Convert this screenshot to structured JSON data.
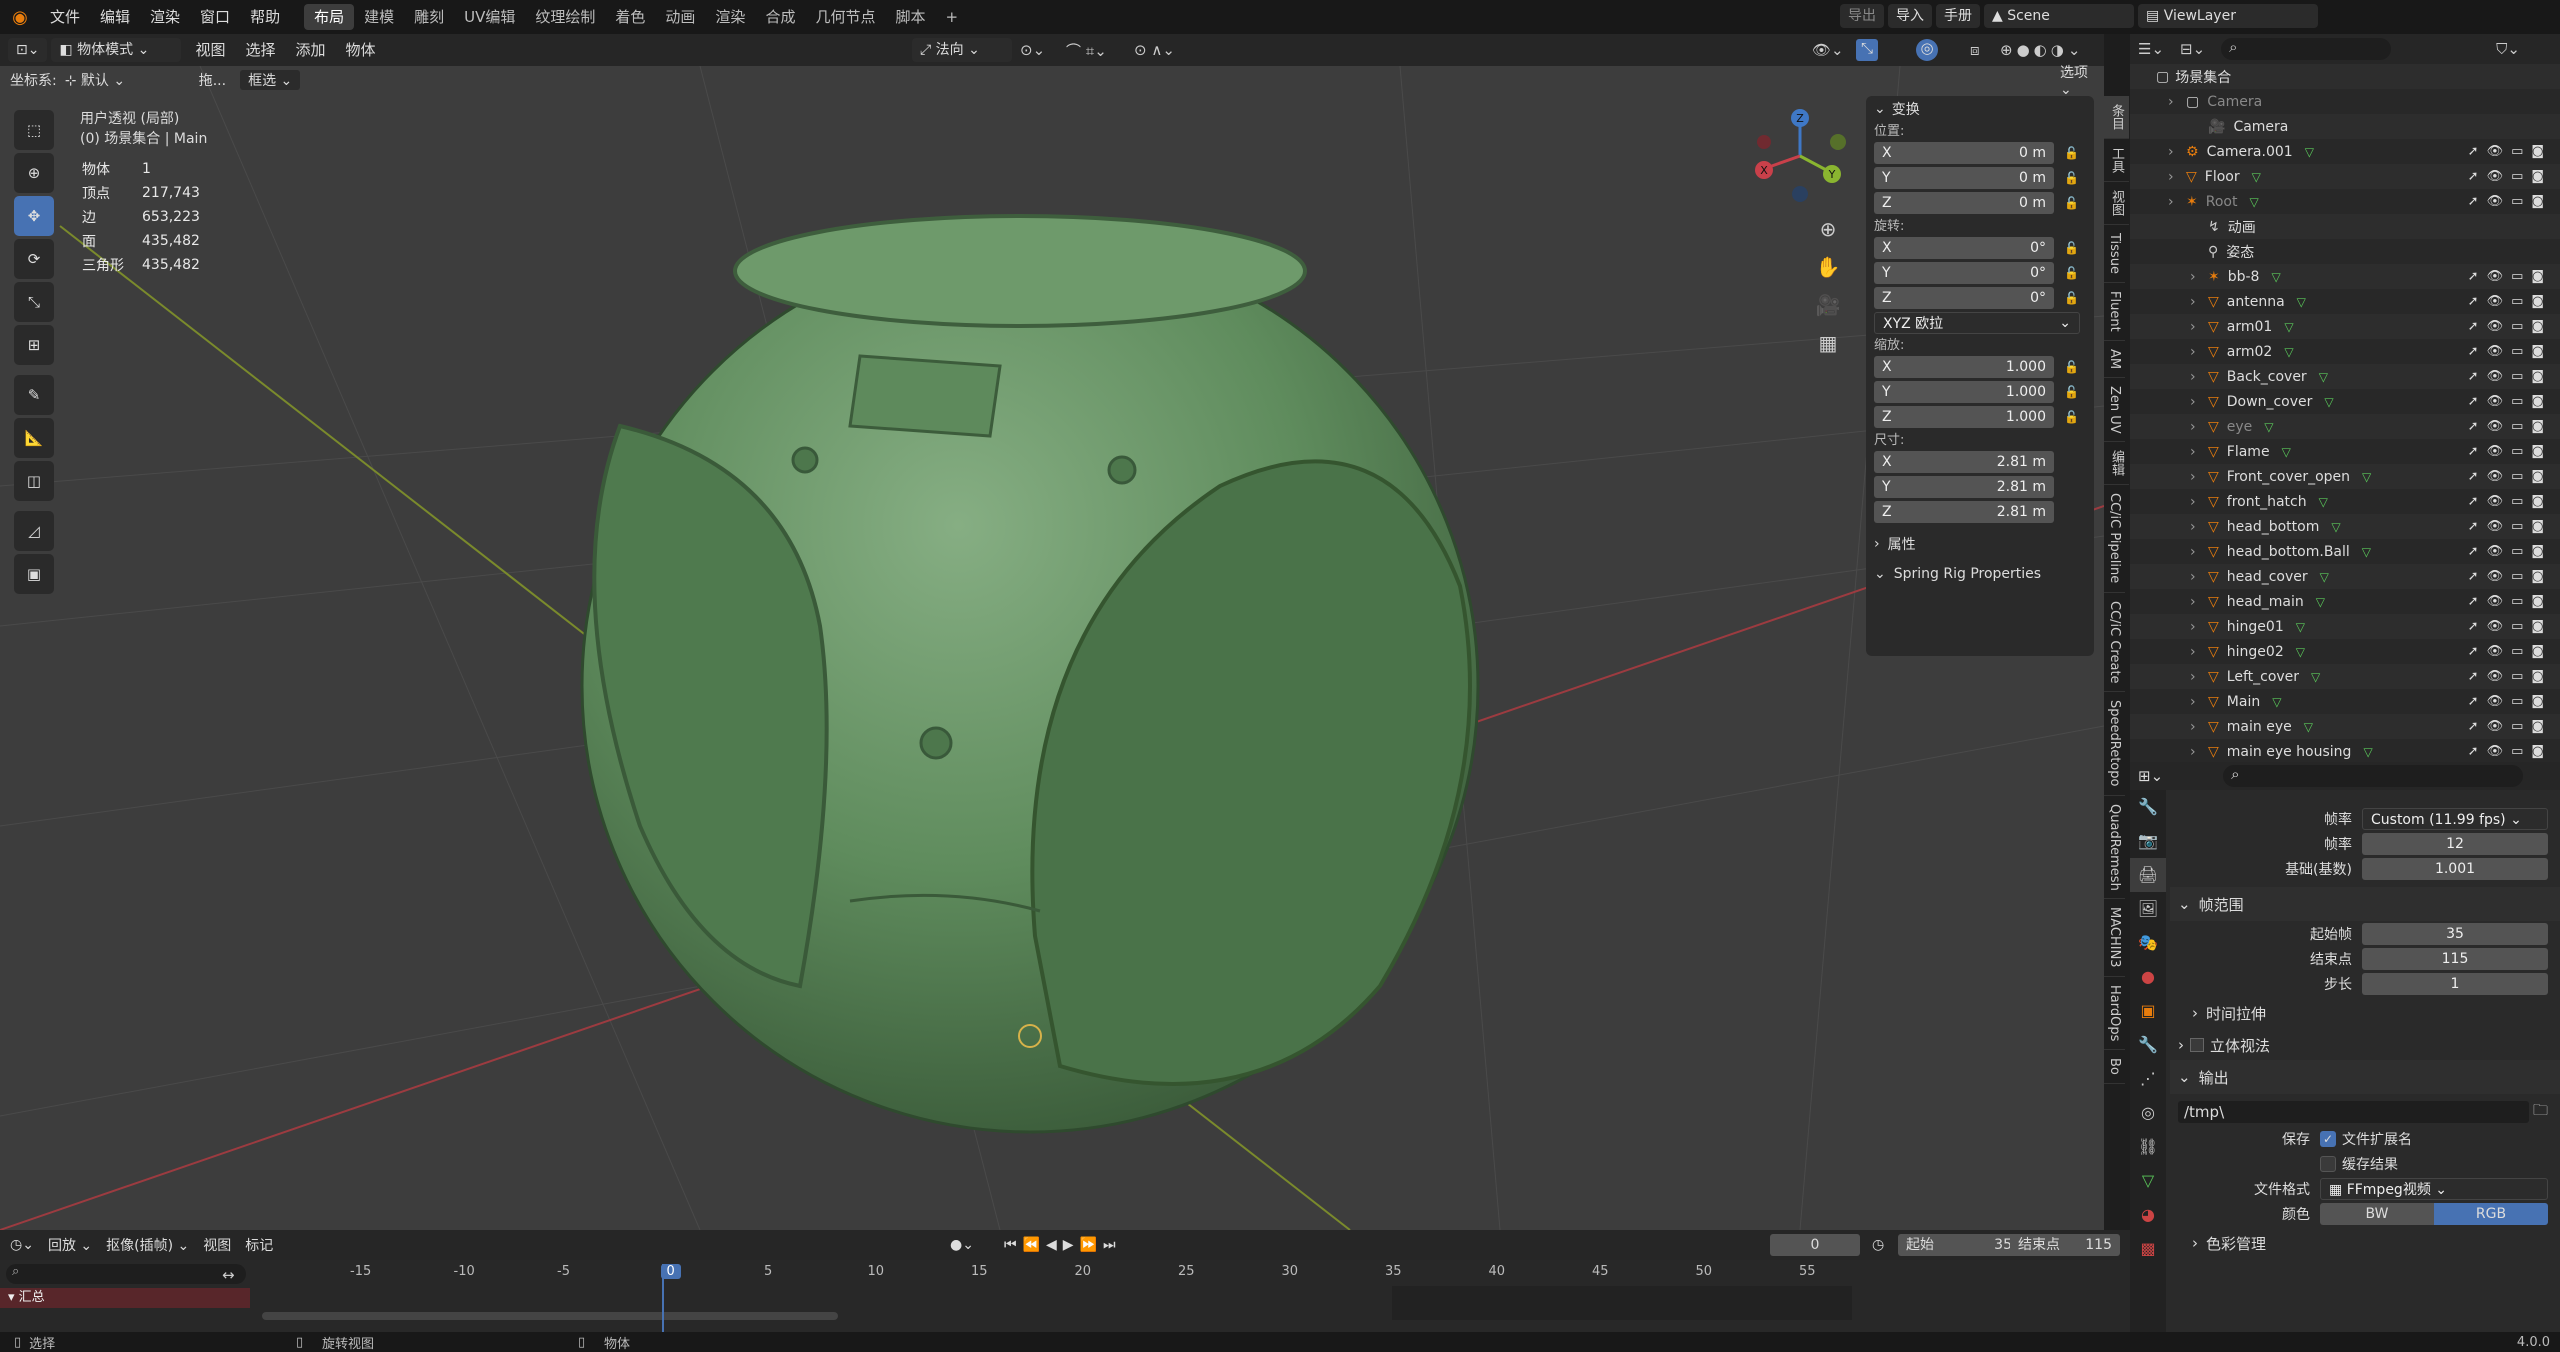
{
  "topbar": {
    "menus": [
      "文件",
      "编辑",
      "渲染",
      "窗口",
      "帮助"
    ],
    "workspaces": [
      "布局",
      "建模",
      "雕刻",
      "UV编辑",
      "纹理绘制",
      "着色",
      "动画",
      "渲染",
      "合成",
      "几何节点",
      "脚本"
    ],
    "active_workspace": "布局",
    "add_tab": "+",
    "export_label": "导出",
    "import_label": "导入",
    "manual_label": "手册",
    "scene_name": "Scene",
    "viewlayer_name": "ViewLayer"
  },
  "viewport_header": {
    "mode": "物体模式",
    "menus": [
      "视图",
      "选择",
      "添加",
      "物体"
    ],
    "orientation": "法向",
    "coord_label": "坐标系:",
    "coord_value": "默认",
    "drag_label": "拖...",
    "select_mode": "框选",
    "options_label": "选项"
  },
  "overlay_info": {
    "view_name": "用户透视 (局部)",
    "collection": "(0) 场景集合 | Main",
    "stats": [
      {
        "label": "物体",
        "value": "1"
      },
      {
        "label": "顶点",
        "value": "217,743"
      },
      {
        "label": "边",
        "value": "653,223"
      },
      {
        "label": "面",
        "value": "435,482"
      },
      {
        "label": "三角形",
        "value": "435,482"
      }
    ]
  },
  "gizmo": {
    "x": "X",
    "y": "Y",
    "z": "Z"
  },
  "npanel": {
    "transform_title": "变换",
    "location_label": "位置:",
    "location": [
      {
        "axis": "X",
        "value": "0 m"
      },
      {
        "axis": "Y",
        "value": "0 m"
      },
      {
        "axis": "Z",
        "value": "0 m"
      }
    ],
    "rotation_label": "旋转:",
    "rotation": [
      {
        "axis": "X",
        "value": "0°"
      },
      {
        "axis": "Y",
        "value": "0°"
      },
      {
        "axis": "Z",
        "value": "0°"
      }
    ],
    "rotation_mode": "XYZ 欧拉",
    "scale_label": "缩放:",
    "scale": [
      {
        "axis": "X",
        "value": "1.000"
      },
      {
        "axis": "Y",
        "value": "1.000"
      },
      {
        "axis": "Z",
        "value": "1.000"
      }
    ],
    "dimensions_label": "尺寸:",
    "dimensions": [
      {
        "axis": "X",
        "value": "2.81 m"
      },
      {
        "axis": "Y",
        "value": "2.81 m"
      },
      {
        "axis": "Z",
        "value": "2.81 m"
      }
    ],
    "properties_title": "属性",
    "spring_title": "Spring Rig Properties"
  },
  "side_tabs": [
    "条目",
    "工具",
    "视图",
    "Tissue",
    "Fluent",
    "AM",
    "Zen UV",
    "编辑",
    "CC/iC Pipeline",
    "CC/iC Create",
    "SpeedRetopo",
    "QuadRemesh",
    "MACHIN3",
    "HardOps",
    "Bo"
  ],
  "outliner": {
    "root": "场景集合",
    "rows": [
      {
        "name": "Camera",
        "indent": 1,
        "dim": true,
        "type": "collection"
      },
      {
        "name": "Camera",
        "indent": 2,
        "dim": false,
        "type": "camera"
      },
      {
        "name": "Camera.001",
        "indent": 1,
        "dim": false,
        "type": "object"
      },
      {
        "name": "Floor",
        "indent": 1,
        "dim": false,
        "type": "mesh"
      },
      {
        "name": "Root",
        "indent": 1,
        "dim": true,
        "type": "armature"
      },
      {
        "name": "动画",
        "indent": 2,
        "dim": false,
        "type": "anim"
      },
      {
        "name": "姿态",
        "indent": 2,
        "dim": false,
        "type": "pose"
      },
      {
        "name": "bb-8",
        "indent": 2,
        "dim": false,
        "type": "armature"
      },
      {
        "name": "antenna",
        "indent": 2,
        "dim": false,
        "type": "mesh"
      },
      {
        "name": "arm01",
        "indent": 2,
        "dim": false,
        "type": "mesh"
      },
      {
        "name": "arm02",
        "indent": 2,
        "dim": false,
        "type": "mesh"
      },
      {
        "name": "Back_cover",
        "indent": 2,
        "dim": false,
        "type": "mesh"
      },
      {
        "name": "Down_cover",
        "indent": 2,
        "dim": false,
        "type": "mesh"
      },
      {
        "name": "eye",
        "indent": 2,
        "dim": true,
        "type": "mesh"
      },
      {
        "name": "Flame",
        "indent": 2,
        "dim": false,
        "type": "mesh"
      },
      {
        "name": "Front_cover_open",
        "indent": 2,
        "dim": false,
        "type": "mesh"
      },
      {
        "name": "front_hatch",
        "indent": 2,
        "dim": false,
        "type": "mesh"
      },
      {
        "name": "head_bottom",
        "indent": 2,
        "dim": false,
        "type": "mesh"
      },
      {
        "name": "head_bottom.Ball",
        "indent": 2,
        "dim": false,
        "type": "mesh"
      },
      {
        "name": "head_cover",
        "indent": 2,
        "dim": false,
        "type": "mesh"
      },
      {
        "name": "head_main",
        "indent": 2,
        "dim": false,
        "type": "mesh"
      },
      {
        "name": "hinge01",
        "indent": 2,
        "dim": false,
        "type": "mesh"
      },
      {
        "name": "hinge02",
        "indent": 2,
        "dim": false,
        "type": "mesh"
      },
      {
        "name": "Left_cover",
        "indent": 2,
        "dim": false,
        "type": "mesh"
      },
      {
        "name": "Main",
        "indent": 2,
        "dim": false,
        "type": "mesh"
      },
      {
        "name": "main eye",
        "indent": 2,
        "dim": false,
        "type": "mesh"
      },
      {
        "name": "main eye housing",
        "indent": 2,
        "dim": false,
        "type": "mesh"
      }
    ]
  },
  "properties": {
    "frame_rate_label": "帧率",
    "frame_rate_value": "Custom (11.99 fps)",
    "fps_label": "帧率",
    "fps_value": "12",
    "base_label": "基础(基数)",
    "base_value": "1.001",
    "frame_range_title": "帧范围",
    "start_label": "起始帧",
    "start_value": "35",
    "end_label": "结束点",
    "end_value": "115",
    "step_label": "步长",
    "step_value": "1",
    "time_stretch": "时间拉伸",
    "stereo": "立体视法",
    "output_title": "输出",
    "output_path": "/tmp\\",
    "save_label": "保存",
    "file_ext": "文件扩展名",
    "cache_result": "缓存结果",
    "file_format_label": "文件格式",
    "file_format_value": "FFmpeg视频",
    "color_label": "颜色",
    "bw": "BW",
    "rgb": "RGB",
    "color_mgmt": "色彩管理"
  },
  "timeline": {
    "playback": "回放",
    "keying": "抠像(插帧)",
    "view": "视图",
    "marker": "标记",
    "current_frame": "0",
    "start_label": "起始",
    "start": "35",
    "end_label": "结束点",
    "end": "115",
    "ticks": [
      "-15",
      "-10",
      "-5",
      "0",
      "5",
      "10",
      "15",
      "20",
      "25",
      "30",
      "35",
      "40",
      "45",
      "50",
      "55"
    ],
    "summary": "汇总"
  },
  "statusbar": {
    "select": "选择",
    "rotate": "旋转视图",
    "object": "物体",
    "version": "4.0.0"
  },
  "colors": {
    "accent": "#4772b3",
    "model_green": "#5e8a5c",
    "x_axis": "#c9404a",
    "y_axis": "#8ab530",
    "z_axis": "#3f78c6"
  }
}
